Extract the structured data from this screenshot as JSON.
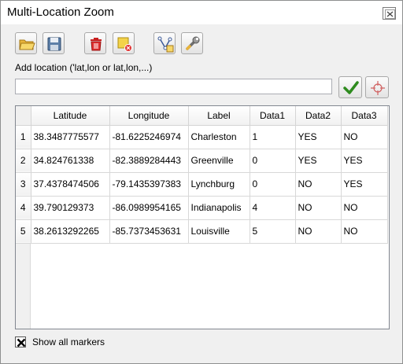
{
  "window": {
    "title": "Multi-Location Zoom"
  },
  "toolbar": {
    "buttons": [
      {
        "icon": "folder-open-icon"
      },
      {
        "icon": "save-icon"
      },
      {
        "icon": "trash-icon"
      },
      {
        "icon": "clear-markers-icon"
      },
      {
        "icon": "add-vertex-icon"
      },
      {
        "icon": "settings-wrench-icon"
      }
    ]
  },
  "add_location": {
    "label": "Add location ('lat,lon or lat,lon,...)",
    "value": "",
    "placeholder": ""
  },
  "table": {
    "columns": [
      "Latitude",
      "Longitude",
      "Label",
      "Data1",
      "Data2",
      "Data3"
    ],
    "rows": [
      {
        "num": "1",
        "cells": [
          "38.3487775577",
          "-81.6225246974",
          "Charleston",
          "1",
          "YES",
          "NO"
        ]
      },
      {
        "num": "2",
        "cells": [
          "34.824761338",
          "-82.3889284443",
          "Greenville",
          "0",
          "YES",
          "YES"
        ]
      },
      {
        "num": "3",
        "cells": [
          "37.4378474506",
          "-79.1435397383",
          "Lynchburg",
          "0",
          "NO",
          "YES"
        ]
      },
      {
        "num": "4",
        "cells": [
          "39.790129373",
          "-86.0989954165",
          "Indianapolis",
          "4",
          "NO",
          "NO"
        ]
      },
      {
        "num": "5",
        "cells": [
          "38.2613292265",
          "-85.7373453631",
          "Louisville",
          "5",
          "NO",
          "NO"
        ]
      }
    ]
  },
  "show_all_markers": {
    "label": "Show all markers",
    "checked": true
  },
  "colors": {
    "apply_check": "#2e8b1e",
    "trash_red": "#d42020",
    "folder_yellow": "#f5c542"
  }
}
